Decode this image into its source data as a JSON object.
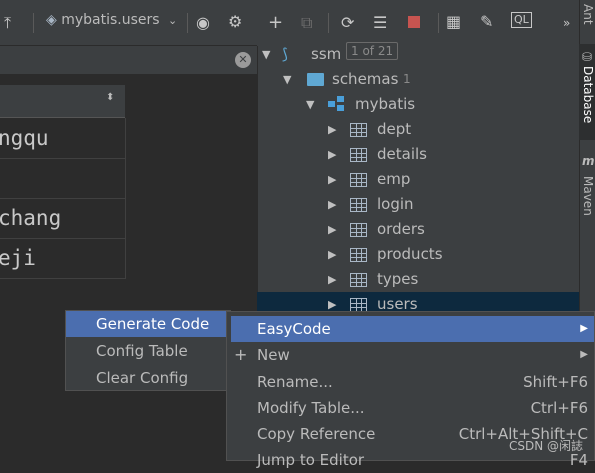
{
  "left": {
    "datasource": "mybatis.users",
    "grid_values": [
      "ngqu",
      "",
      "chang",
      "eji"
    ]
  },
  "tree": {
    "root": "ssm",
    "root_badge": "1 of 21",
    "schemas": "schemas",
    "schemas_count": "1",
    "database": "mybatis",
    "tables": [
      "dept",
      "details",
      "emp",
      "login",
      "orders",
      "products",
      "types",
      "users"
    ]
  },
  "side_tabs": {
    "ant": "Ant",
    "database": "Database",
    "maven": "Maven"
  },
  "submenu": {
    "items": [
      "Generate Code",
      "Config Table",
      "Clear Config"
    ]
  },
  "context_menu": {
    "easycode": "EasyCode",
    "new": "New",
    "rename": "Rename...",
    "rename_shortcut": "Shift+F6",
    "modify": "Modify Table...",
    "modify_shortcut": "Ctrl+F6",
    "copy_ref": "Copy Reference",
    "copy_ref_shortcut": "Ctrl+Alt+Shift+C",
    "jump": "Jump to Editor",
    "jump_shortcut": "F4"
  },
  "watermark": "CSDN @闲誌",
  "colors": {
    "highlight": "#4b6eaf",
    "selection": "#0d293e",
    "stop": "#c75450"
  }
}
